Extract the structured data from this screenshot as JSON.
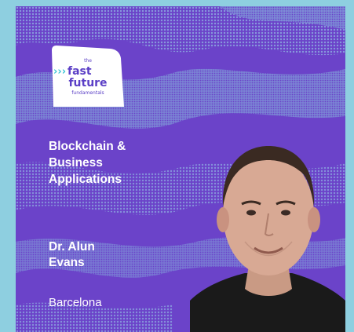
{
  "logo": {
    "line_the": "the",
    "line_fast": "fast",
    "line_future": "future",
    "line_fundamentals": "fundamentals"
  },
  "topic": {
    "line1": "Blockchain &",
    "line2": "Business",
    "line3": "Applications"
  },
  "speaker": {
    "line1": "Dr. Alun",
    "line2": "Evans"
  },
  "location": "Barcelona",
  "colors": {
    "outer_background": "#8ecfe0",
    "card_purple": "#6b43c9",
    "texture_blue": "#7b8fd8",
    "logo_text": "#5b3fc6",
    "logo_accent": "#3fc6d6",
    "text": "#ffffff"
  }
}
